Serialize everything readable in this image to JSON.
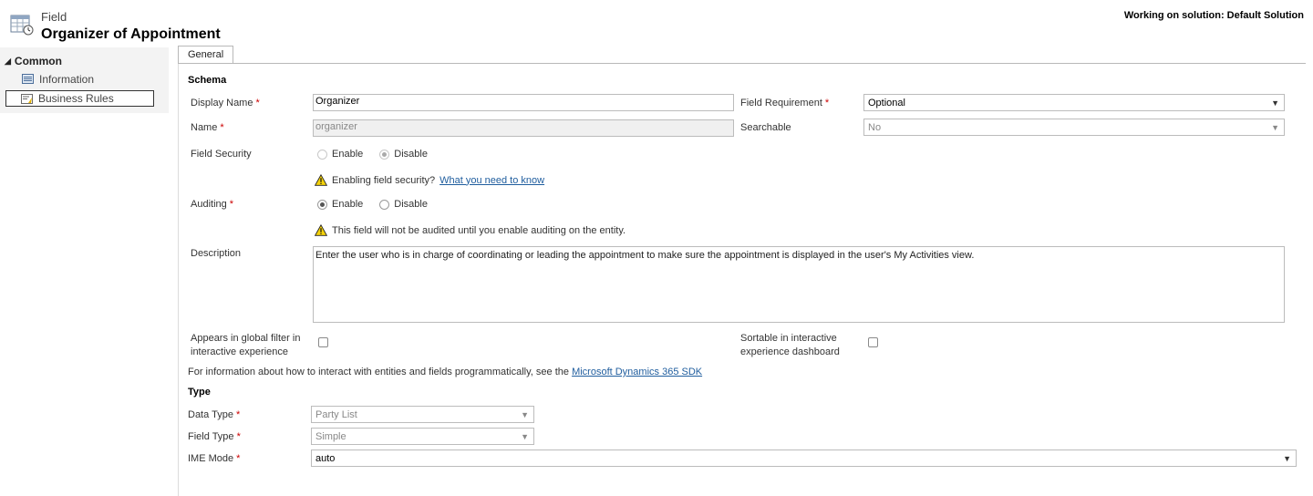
{
  "header": {
    "kind": "Field",
    "title": "Organizer of Appointment",
    "solution": "Working on solution: Default Solution",
    "icon": "entity-field-icon"
  },
  "nav": {
    "group": "Common",
    "items": [
      {
        "label": "Information",
        "icon": "form-icon",
        "selected": false
      },
      {
        "label": "Business Rules",
        "icon": "business-rules-icon",
        "selected": true
      }
    ]
  },
  "tabs": [
    {
      "label": "General",
      "active": true
    }
  ],
  "schema": {
    "section": "Schema",
    "display_name": {
      "label": "Display Name",
      "value": "Organizer"
    },
    "name": {
      "label": "Name",
      "value": "organizer"
    },
    "field_requirement": {
      "label": "Field Requirement",
      "value": "Optional"
    },
    "searchable": {
      "label": "Searchable",
      "value": "No"
    },
    "field_security": {
      "label": "Field Security",
      "enable": "Enable",
      "disable": "Disable",
      "selected": "Disable",
      "warning": "Enabling field security?",
      "warning_link": "What you need to know"
    },
    "auditing": {
      "label": "Auditing",
      "enable": "Enable",
      "disable": "Disable",
      "selected": "Enable",
      "warning": "This field will not be audited until you enable auditing on the entity."
    },
    "description": {
      "label": "Description",
      "value": "Enter the user who is in charge of coordinating or leading the appointment to make sure the appointment is displayed in the user's My Activities view."
    },
    "global_filter": {
      "label_line1": "Appears in global filter in",
      "label_line2": "interactive experience",
      "checked": false
    },
    "sortable": {
      "label_line1": "Sortable in interactive",
      "label_line2": "experience dashboard",
      "checked": false
    },
    "sdk_text": "For information about how to interact with entities and fields programmatically, see the",
    "sdk_link": "Microsoft Dynamics 365 SDK"
  },
  "type": {
    "section": "Type",
    "data_type": {
      "label": "Data Type",
      "value": "Party List"
    },
    "field_type": {
      "label": "Field Type",
      "value": "Simple"
    },
    "ime_mode": {
      "label": "IME Mode",
      "value": "auto"
    }
  },
  "colors": {
    "required": "#cc0000",
    "link": "#1f5d9e",
    "nav_bg": "#f3f3f3"
  }
}
